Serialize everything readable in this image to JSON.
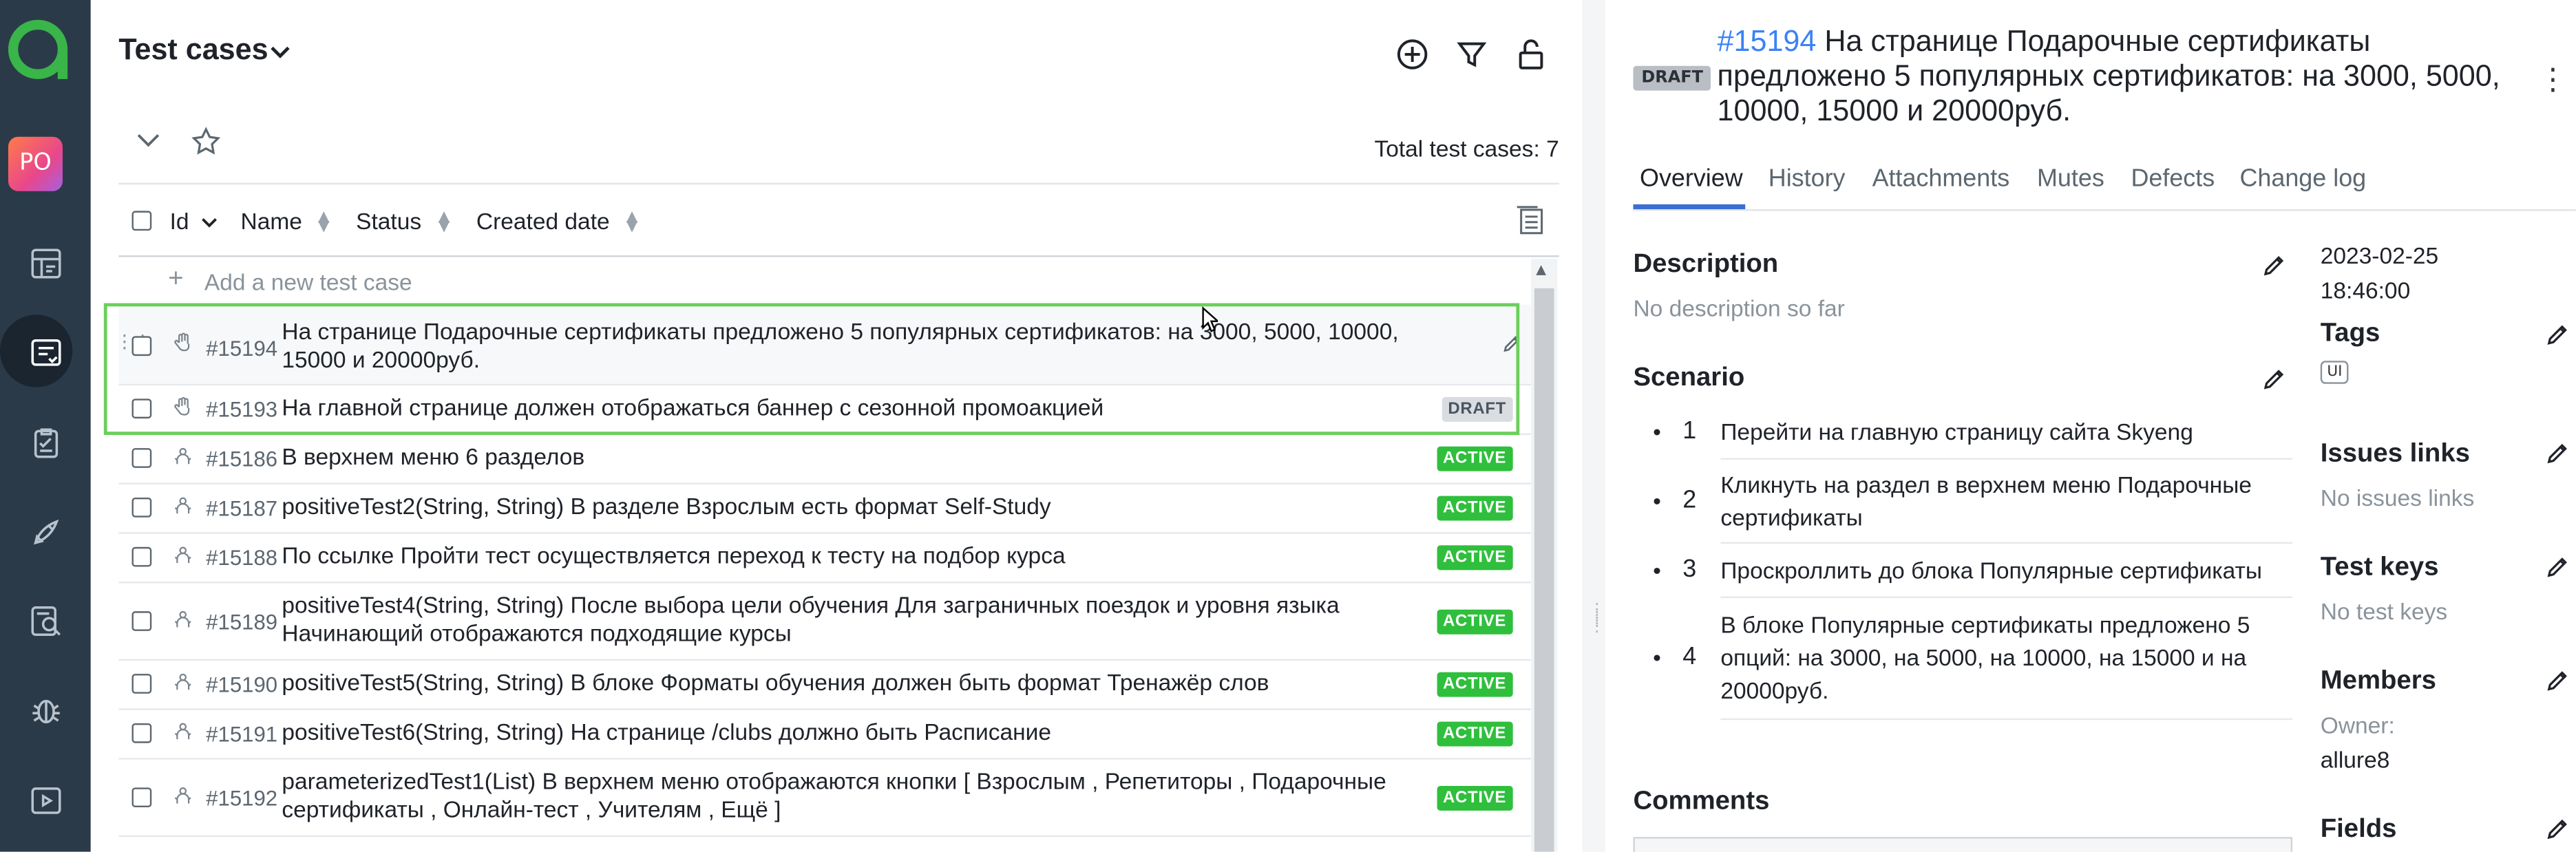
{
  "rail": {
    "avatar_initials": "PO",
    "items": [
      "dashboards-icon",
      "test-cases-icon",
      "test-plans-icon",
      "launches-icon",
      "analytics-icon",
      "defects-icon",
      "jobs-icon"
    ]
  },
  "list": {
    "title": "Test cases",
    "total_label": "Total test cases: 7",
    "columns": {
      "id": "Id",
      "name": "Name",
      "status": "Status",
      "created": "Created date"
    },
    "add_new": "Add a new test case",
    "rows": [
      {
        "id": "#15194",
        "name": "На странице Подарочные сертификаты предложено 5 популярных сертификатов: на 3000, 5000, 10000, 15000 и 20000руб.",
        "status": "",
        "manual": true
      },
      {
        "id": "#15193",
        "name": "На главной странице должен отображаться баннер с сезонной промоакцией",
        "status": "DRAFT",
        "manual": true
      },
      {
        "id": "#15186",
        "name": "В верхнем меню 6 разделов",
        "status": "ACTIVE",
        "manual": false
      },
      {
        "id": "#15187",
        "name": "positiveTest2(String, String) В разделе Взрослым есть формат Self-Study",
        "status": "ACTIVE",
        "manual": false
      },
      {
        "id": "#15188",
        "name": "По ссылке Пройти тест осуществляется переход к тесту на подбор курса",
        "status": "ACTIVE",
        "manual": false
      },
      {
        "id": "#15189",
        "name": "positiveTest4(String, String) После выбора цели обучения Для заграничных поездок и уровня языка Начинающий отображаются подходящие курсы",
        "status": "ACTIVE",
        "manual": false
      },
      {
        "id": "#15190",
        "name": "positiveTest5(String, String) В блоке Форматы обучения должен быть формат Тренажёр слов",
        "status": "ACTIVE",
        "manual": false
      },
      {
        "id": "#15191",
        "name": "positiveTest6(String, String) На странице /clubs должно быть Расписание",
        "status": "ACTIVE",
        "manual": false
      },
      {
        "id": "#15192",
        "name": "parameterizedTest1(List) В верхнем меню отображаются кнопки [ Взрослым , Репетиторы , Подарочные сертификаты , Онлайн-тест , Учителям , Ещё ]",
        "status": "ACTIVE",
        "manual": false
      }
    ]
  },
  "detail": {
    "status_badge": "DRAFT",
    "id": "#15194",
    "title": "На странице Подарочные сертификаты предложено 5 популярных сертификатов: на 3000, 5000, 10000, 15000 и 20000руб.",
    "tabs": [
      "Overview",
      "History",
      "Attachments",
      "Mutes",
      "Defects",
      "Change log"
    ],
    "active_tab": "Overview",
    "description_heading": "Description",
    "description_empty": "No description so far",
    "scenario_heading": "Scenario",
    "steps": [
      {
        "n": "1",
        "text": "Перейти на главную страницу сайта Skyeng"
      },
      {
        "n": "2",
        "text": "Кликнуть на раздел в верхнем меню Подарочные сертификаты"
      },
      {
        "n": "3",
        "text": "Проскроллить до блока Популярные сертификаты"
      },
      {
        "n": "4",
        "text": "В блоке Популярные сертификаты предложено 5 опций: на 3000, на 5000, на 10000, на 15000 и на 20000руб."
      }
    ],
    "comments_heading": "Comments",
    "created_date": "2023-02-25",
    "created_time": "18:46:00",
    "tags_heading": "Tags",
    "tags": [
      "UI"
    ],
    "issues_heading": "Issues links",
    "issues_empty": "No issues links",
    "keys_heading": "Test keys",
    "keys_empty": "No test keys",
    "members_heading": "Members",
    "owner_label": "Owner:",
    "owner": "allure8",
    "fields_heading": "Fields"
  },
  "colors": {
    "rail": "#2b3a48",
    "accent": "#3b6fd4",
    "active": "#2fbf3d",
    "selection": "#6ad05a",
    "link": "#3b82f6"
  }
}
